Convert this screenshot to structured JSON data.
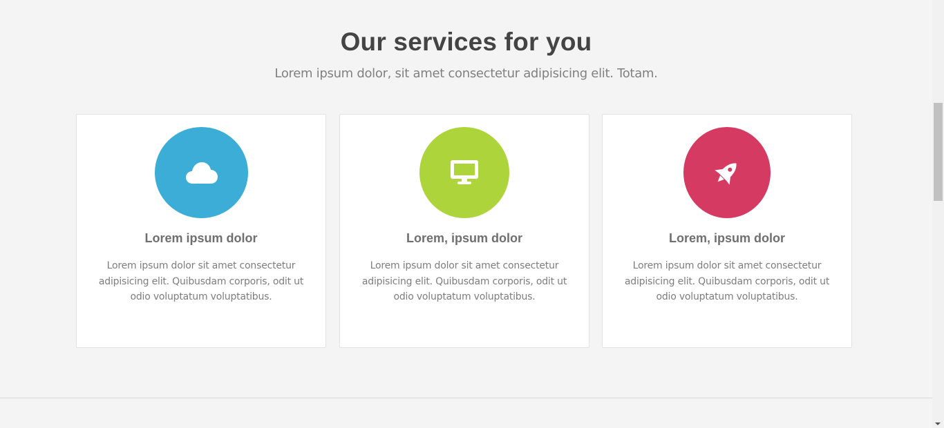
{
  "section": {
    "title": "Our services for you",
    "subtitle": "Lorem ipsum dolor, sit amet consectetur adipisicing elit. Totam."
  },
  "cards": [
    {
      "icon": "cloud-icon",
      "color": "#3badd6",
      "title": "Lorem ipsum dolor",
      "text": "Lorem ipsum dolor sit amet consectetur adipisicing elit. Quibusdam corporis, odit ut odio voluptatum voluptatibus."
    },
    {
      "icon": "desktop-icon",
      "color": "#add53b",
      "title": "Lorem, ipsum dolor",
      "text": "Lorem ipsum dolor sit amet consectetur adipisicing elit. Quibusdam corporis, odit ut odio voluptatum voluptatibus."
    },
    {
      "icon": "rocket-icon",
      "color": "#d53b62",
      "title": "Lorem, ipsum dolor",
      "text": "Lorem ipsum dolor sit amet consectetur adipisicing elit. Quibusdam corporis, odit ut odio voluptatum voluptatibus."
    }
  ],
  "colors": {
    "background": "#f4f4f4",
    "card_background": "#ffffff",
    "title": "#444444",
    "subtitle": "#808080"
  }
}
